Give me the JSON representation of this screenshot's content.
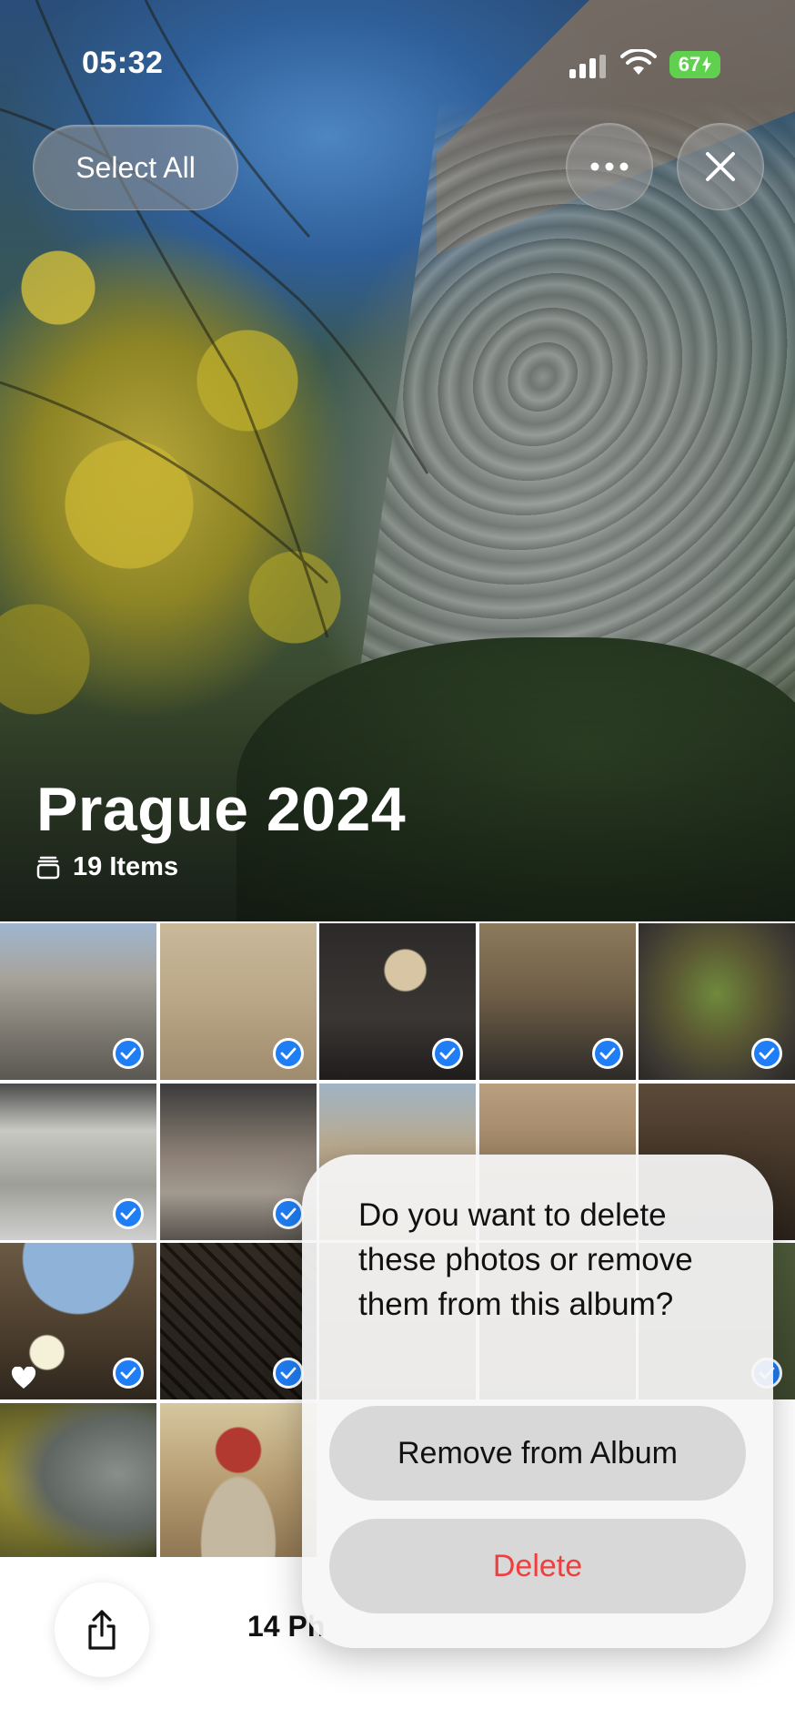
{
  "status_bar": {
    "time": "05:32",
    "battery": "67",
    "icons": [
      "cellular-signal-icon",
      "wifi-icon",
      "battery-charging-icon"
    ]
  },
  "header": {
    "select_all_label": "Select All",
    "more_icon": "ellipsis-icon",
    "close_icon": "close-icon"
  },
  "album": {
    "title": "Prague 2024",
    "count_label": "19 Items",
    "count_icon": "stack-icon"
  },
  "grid": {
    "selected_count": 14,
    "tiles": [
      {
        "subject": "building facade",
        "selected": true
      },
      {
        "subject": "courtyard arches",
        "selected": true
      },
      {
        "subject": "fossil display",
        "selected": true
      },
      {
        "subject": "museum hall specimen",
        "selected": true
      },
      {
        "subject": "green mineral",
        "selected": true
      },
      {
        "subject": "crystal showcase",
        "selected": true
      },
      {
        "subject": "mineral shelf",
        "selected": true
      },
      {
        "subject": "glass roof hall",
        "selected": true
      },
      {
        "subject": "arched gallery",
        "selected": true
      },
      {
        "subject": "dark carvings",
        "selected": true
      },
      {
        "subject": "glass dome",
        "selected": true,
        "favorite": true
      },
      {
        "subject": "giraffe skeleton",
        "selected": true
      },
      {
        "subject": "hall interior",
        "selected": false
      },
      {
        "subject": "museum corridor",
        "selected": false
      },
      {
        "subject": "green sculpture",
        "selected": true
      },
      {
        "subject": "dripstone wall",
        "selected": false
      },
      {
        "subject": "painted ceiling",
        "selected": false
      }
    ]
  },
  "dialog": {
    "message": "Do you want to delete these photos or remove them from this album?",
    "remove_label": "Remove from Album",
    "delete_label": "Delete"
  },
  "bottom_bar": {
    "share_icon": "share-icon",
    "count_label": "14 Ph"
  },
  "colors": {
    "accent": "#1f7ef5",
    "destructive": "#f03e3e",
    "battery": "#5fd14e"
  }
}
